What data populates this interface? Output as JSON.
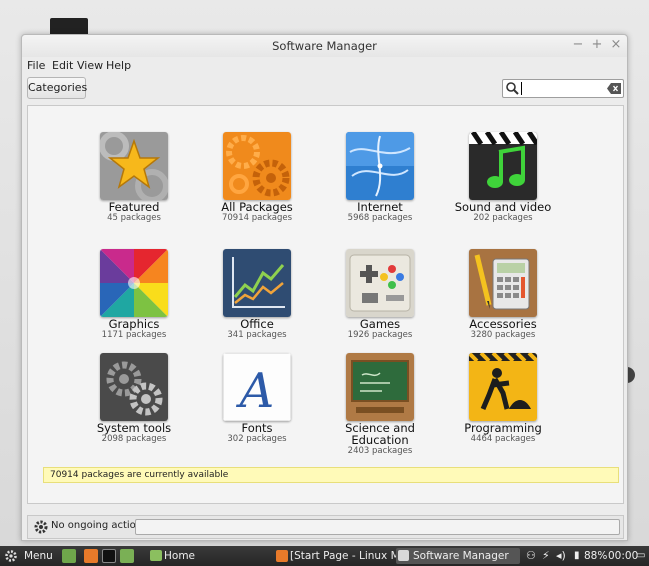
{
  "window": {
    "title": "Software Manager"
  },
  "menu": [
    "File",
    "Edit",
    "View",
    "Help"
  ],
  "toolbar": {
    "categories_label": "Categories"
  },
  "search": {
    "value": "",
    "placeholder": ""
  },
  "categories": [
    {
      "name": "Featured",
      "count": "45 packages",
      "icon": "star-icon"
    },
    {
      "name": "All Packages",
      "count": "70914 packages",
      "icon": "gears-icon"
    },
    {
      "name": "Internet",
      "count": "5968 packages",
      "icon": "globe-icon"
    },
    {
      "name": "Sound and video",
      "count": "202 packages",
      "icon": "music-clapper-icon"
    },
    {
      "name": "Graphics",
      "count": "1171 packages",
      "icon": "color-wheel-icon"
    },
    {
      "name": "Office",
      "count": "341 packages",
      "icon": "line-chart-icon"
    },
    {
      "name": "Games",
      "count": "1926 packages",
      "icon": "game-controller-icon"
    },
    {
      "name": "Accessories",
      "count": "3280 packages",
      "icon": "calculator-icon"
    },
    {
      "name": "System tools",
      "count": "2098 packages",
      "icon": "system-gears-icon"
    },
    {
      "name": "Fonts",
      "count": "302 packages",
      "icon": "font-icon"
    },
    {
      "name": "Science and Education",
      "count": "2403 packages",
      "icon": "chalkboard-icon"
    },
    {
      "name": "Programming",
      "count": "4464 packages",
      "icon": "construction-sign-icon"
    }
  ],
  "status_note": "70914 packages are currently available",
  "actions": {
    "label": "No ongoing actions"
  },
  "taskbar": {
    "menu_label": "Menu",
    "home_label": "Home",
    "browser_label": "[Start Page - Linux M...",
    "active_label": "Software Manager",
    "battery": "88%",
    "clock": "00:00"
  }
}
